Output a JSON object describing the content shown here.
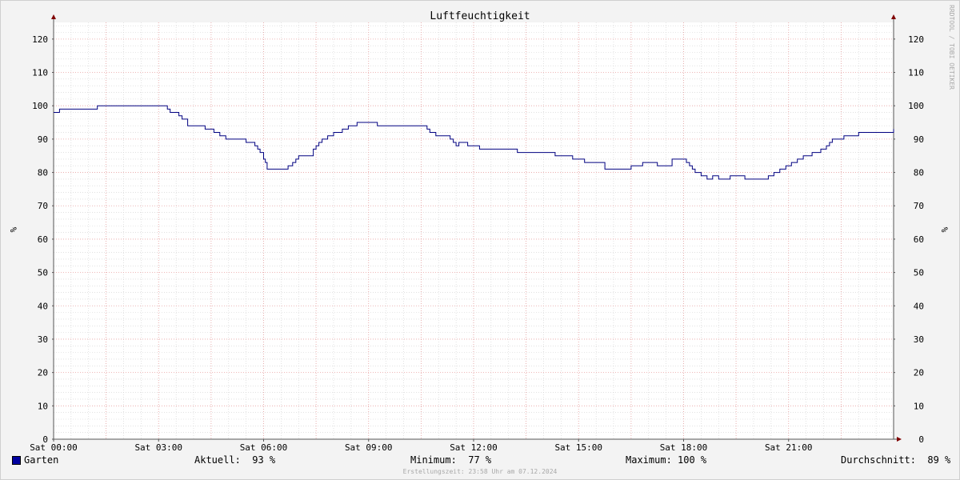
{
  "chart_data": {
    "type": "line",
    "title": "Luftfeuchtigkeit",
    "ylabel": "%",
    "ylabel_right": "%",
    "watermark": "RRDTOOL / TOBI OETIKER",
    "ylim": [
      0,
      125
    ],
    "y_ticks": [
      0,
      10,
      20,
      30,
      40,
      50,
      60,
      70,
      80,
      90,
      100,
      110,
      120
    ],
    "y_tick_labels": [
      "0",
      "10",
      "20",
      "30",
      "40",
      "50",
      "60",
      "70",
      "80",
      "90",
      "100",
      "110",
      "120"
    ],
    "xlim": [
      0,
      24
    ],
    "x_ticks": [
      0,
      3,
      6,
      9,
      12,
      15,
      18,
      21
    ],
    "x_tick_labels": [
      "Sat 00:00",
      "Sat 03:00",
      "Sat 06:00",
      "Sat 09:00",
      "Sat 12:00",
      "Sat 15:00",
      "Sat 18:00",
      "Sat 21:00"
    ],
    "x_unit": "hours",
    "grid": true,
    "colors": {
      "line": "#000080",
      "major_grid": "#e8a0a0",
      "minor_grid": "#d0d0d0",
      "axis": "#800000",
      "background": "#f3f3f3",
      "plot": "#ffffff"
    },
    "series": [
      {
        "name": "Garten",
        "x": [
          0,
          0.08,
          0.17,
          0.75,
          1.25,
          2.58,
          3.25,
          3.33,
          3.5,
          3.58,
          3.67,
          3.83,
          4.25,
          4.33,
          4.58,
          4.75,
          4.92,
          5.08,
          5.5,
          5.58,
          5.75,
          5.83,
          5.9,
          6.0,
          6.05,
          6.1,
          6.5,
          6.6,
          6.7,
          6.83,
          6.92,
          7.0,
          7.33,
          7.42,
          7.5,
          7.58,
          7.67,
          7.83,
          8.0,
          8.25,
          8.42,
          8.58,
          8.67,
          8.92,
          9.25,
          10.0,
          10.67,
          10.75,
          10.92,
          11.0,
          11.33,
          11.42,
          11.5,
          11.58,
          11.83,
          12.17,
          13.25,
          14.0,
          14.33,
          14.58,
          14.83,
          15.17,
          15.75,
          16.17,
          16.33,
          16.5,
          16.67,
          16.75,
          16.83,
          17.25,
          17.67,
          17.92,
          18.08,
          18.17,
          18.25,
          18.33,
          18.5,
          18.67,
          18.75,
          18.83,
          19.0,
          19.17,
          19.33,
          19.42,
          19.75,
          20.25,
          20.42,
          20.5,
          20.58,
          20.75,
          20.92,
          21.08,
          21.25,
          21.42,
          21.67,
          21.92,
          22.08,
          22.17,
          22.25,
          22.58,
          23.0,
          24.0
        ],
        "values": [
          98,
          98,
          99,
          99,
          100,
          100,
          99,
          98,
          98,
          97,
          96,
          94,
          94,
          93,
          92,
          91,
          90,
          90,
          89,
          89,
          88,
          87,
          86,
          84,
          83,
          81,
          81,
          81,
          82,
          83,
          84,
          85,
          85,
          87,
          88,
          89,
          90,
          91,
          92,
          93,
          94,
          94,
          95,
          95,
          94,
          94,
          93,
          92,
          91,
          91,
          90,
          89,
          88,
          89,
          88,
          87,
          86,
          86,
          85,
          85,
          84,
          83,
          81,
          81,
          81,
          82,
          82,
          82,
          83,
          82,
          84,
          84,
          83,
          82,
          81,
          80,
          79,
          78,
          78,
          79,
          78,
          78,
          79,
          79,
          78,
          78,
          79,
          79,
          80,
          81,
          82,
          83,
          84,
          85,
          86,
          87,
          88,
          89,
          90,
          91,
          92,
          93
        ]
      }
    ]
  },
  "legend": {
    "series_name": "Garten",
    "current": "Aktuell:  93 %",
    "minimum": "Minimum:  77 %",
    "maximum": "Maximum: 100 %",
    "average": "Durchschnitt:  89 %"
  },
  "footer": "Erstellungszeit: 23:58 Uhr am 07.12.2024"
}
